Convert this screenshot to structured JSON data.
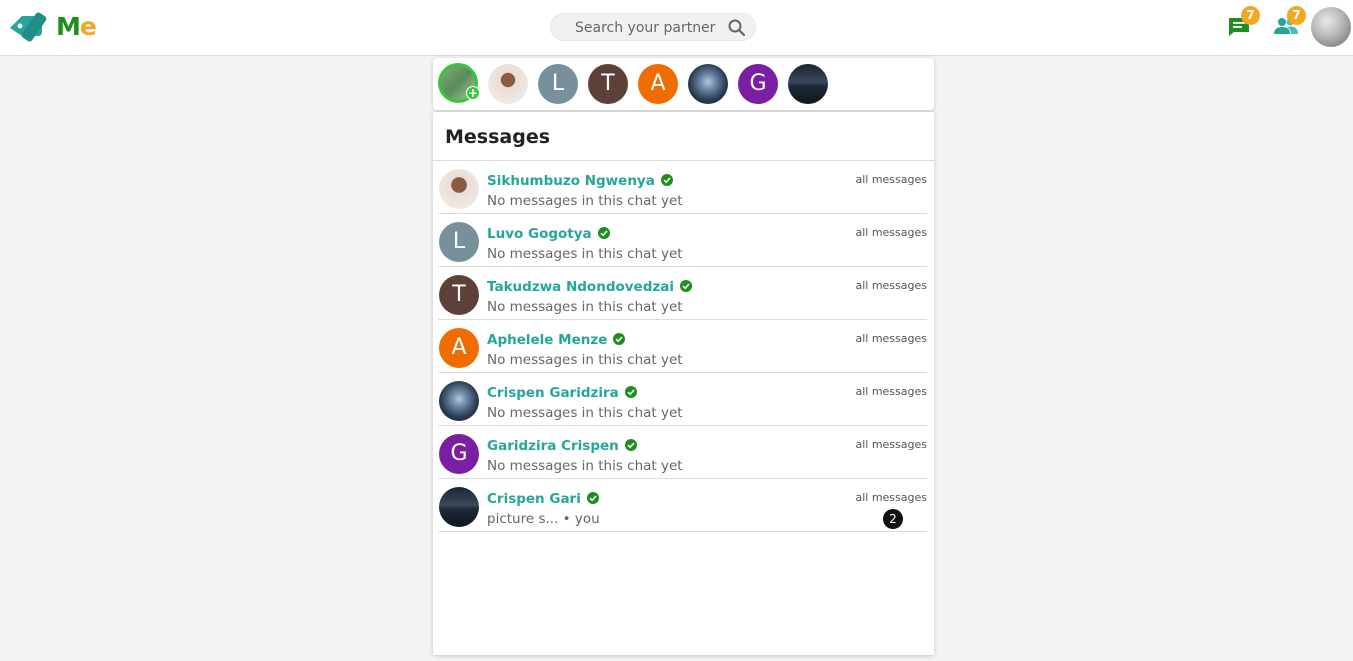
{
  "header": {
    "brand_m": "M",
    "brand_e": "e",
    "search_placeholder": "Search your partner",
    "messages_badge": "7",
    "partners_badge": "7",
    "icons": {
      "logo": "tag-logo-icon",
      "search": "search-icon",
      "messages": "chat-icon",
      "partners": "people-icon"
    },
    "colors": {
      "brand_green": "#1e8e1e",
      "brand_orange": "#f5a623",
      "accent_teal": "#26a69a",
      "badge": "#f5a623"
    }
  },
  "stories": [
    {
      "initial": "",
      "kind": "me-photo",
      "color": "#6a9e6a"
    },
    {
      "initial": "",
      "kind": "photo",
      "color": "#c9a48c"
    },
    {
      "initial": "L",
      "color": "#78909c"
    },
    {
      "initial": "T",
      "color": "#5d4037"
    },
    {
      "initial": "A",
      "color": "#ef6c00"
    },
    {
      "initial": "",
      "kind": "photo",
      "color": "#2b3e55"
    },
    {
      "initial": "G",
      "color": "#7b1fa2"
    },
    {
      "initial": "",
      "kind": "photo",
      "color": "#1f2a38"
    }
  ],
  "messages": {
    "title": "Messages",
    "conversations": [
      {
        "name": "Sikhumbuzo Ngwenya",
        "preview": "No messages in this chat yet",
        "link": "all messages",
        "initial": "",
        "color": "#c9a48c"
      },
      {
        "name": "Luvo Gogotya",
        "preview": "No messages in this chat yet",
        "link": "all messages",
        "initial": "L",
        "color": "#78909c"
      },
      {
        "name": "Takudzwa Ndondovedzai",
        "preview": "No messages in this chat yet",
        "link": "all messages",
        "initial": "T",
        "color": "#5d4037"
      },
      {
        "name": "Aphelele Menze",
        "preview": "No messages in this chat yet",
        "link": "all messages",
        "initial": "A",
        "color": "#ef6c00"
      },
      {
        "name": "Crispen Garidzira",
        "preview": "No messages in this chat yet",
        "link": "all messages",
        "initial": "",
        "color": "#2b3e55"
      },
      {
        "name": "Garidzira Crispen",
        "preview": "No messages in this chat yet",
        "link": "all messages",
        "initial": "G",
        "color": "#7b1fa2"
      },
      {
        "name": "Crispen Gari",
        "preview": "picture s... • you",
        "link": "all messages",
        "initial": "",
        "color": "#1f2a38",
        "unread": "2"
      }
    ]
  }
}
